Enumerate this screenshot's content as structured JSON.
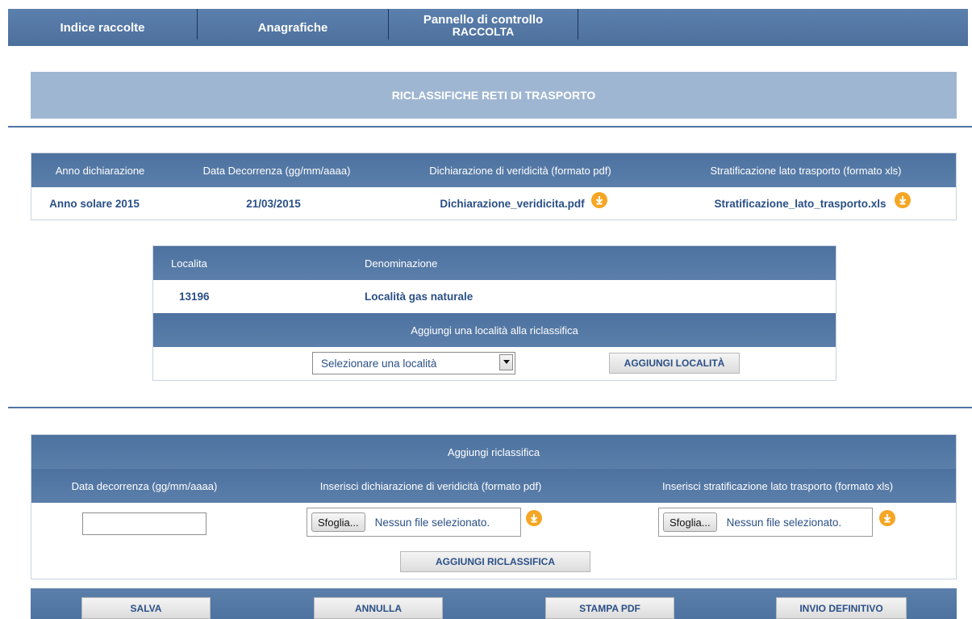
{
  "nav": {
    "items": [
      {
        "label": "Indice raccolte"
      },
      {
        "label": "Anagrafiche"
      },
      {
        "label_line1": "Pannello di controllo",
        "label_line2": "RACCOLTA"
      }
    ]
  },
  "banner": {
    "title": "RICLASSIFICHE RETI DI TRASPORTO"
  },
  "declaration_table": {
    "headers": [
      "Anno dichiarazione",
      "Data Decorrenza (gg/mm/aaaa)",
      "Dichiarazione di veridicità (formato pdf)",
      "Stratificazione lato trasporto (formato xls)"
    ],
    "row": {
      "anno": "Anno solare 2015",
      "data": "21/03/2015",
      "pdf_file": "Dichiarazione_veridicita.pdf",
      "xls_file": "Stratificazione_lato_trasporto.xls"
    }
  },
  "localita_table": {
    "headers": [
      "Localita",
      "Denominazione"
    ],
    "rows": [
      {
        "codice": "13196",
        "denominazione": "Località gas naturale"
      }
    ],
    "add_header": "Aggiungi una località alla riclassifica",
    "select_value": "Selezionare una località",
    "add_button": "AGGIUNGI LOCALITÀ"
  },
  "add_section": {
    "title": "Aggiungi riclassifica",
    "headers": [
      "Data decorrenza (gg/mm/aaaa)",
      "Inserisci dichiarazione di veridicità (formato pdf)",
      "Inserisci stratificazione lato trasporto (formato xls)"
    ],
    "date_value": "",
    "browse_label": "Sfoglia...",
    "no_file_text": "Nessun file selezionato.",
    "add_button": "AGGIUNGI RICLASSIFICA"
  },
  "footer": {
    "buttons": [
      "SALVA",
      "ANNULLA",
      "STAMPA PDF",
      "INVIO DEFINITIVO"
    ]
  },
  "colors": {
    "nav_bg": "#5c80ad",
    "header_bg": "#4e72a0",
    "banner_bg": "#9fb6d2",
    "download_icon": "#f5a623"
  }
}
